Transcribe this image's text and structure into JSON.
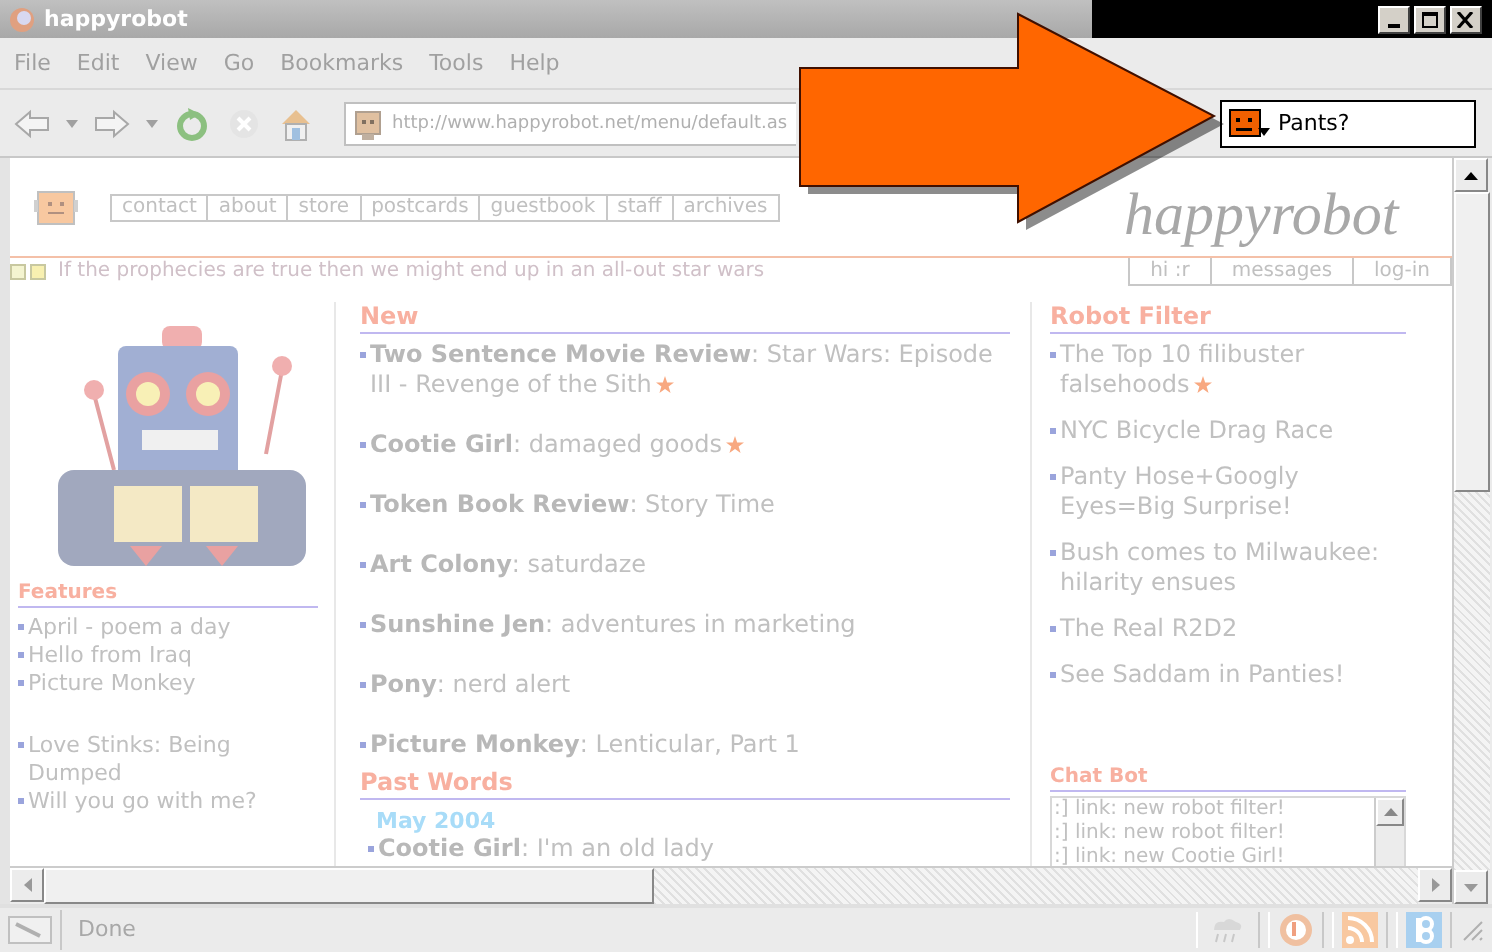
{
  "window": {
    "title": "happyrobot"
  },
  "menu": [
    "File",
    "Edit",
    "View",
    "Go",
    "Bookmarks",
    "Tools",
    "Help"
  ],
  "toolbar": {
    "address": "http://www.happyrobot.net/menu/default.as",
    "search": "Pants?"
  },
  "page": {
    "nav": [
      "contact",
      "about",
      "store",
      "postcards",
      "guestbook",
      "staff",
      "archives"
    ],
    "logo": "happyrobot",
    "user_nav": [
      "hi :r",
      "messages",
      "log-in"
    ],
    "tagline": "If the prophecies are true then we might end up in an all-out star wars",
    "features": {
      "title": "Features",
      "groups": [
        [
          "April - poem a day",
          "Hello from Iraq",
          "Picture Monkey"
        ],
        [
          "Love Stinks: Being Dumped",
          "Will you go with me?"
        ]
      ]
    },
    "new": {
      "title": "New",
      "items": [
        {
          "text": "**Two Sentence Movie Review**: Star Wars: Episode III - Revenge of the Sith",
          "starred": true
        },
        {
          "text": "**Cootie Girl**: damaged goods",
          "starred": true
        },
        {
          "text": "**Token Book Review**: Story Time",
          "starred": false
        },
        {
          "text": "**Art Colony**: saturdaze",
          "starred": false
        },
        {
          "text": "**Sunshine Jen**: adventures in marketing",
          "starred": false
        },
        {
          "text": "**Pony**: nerd alert",
          "starred": false
        },
        {
          "text": "**Picture Monkey**: Lenticular, Part 1",
          "starred": false
        }
      ]
    },
    "past_words": {
      "title": "Past Words",
      "month": "May 2004",
      "items": [
        "**Cootie Girl**: I'm an old lady"
      ]
    },
    "robot_filter": {
      "title": "Robot Filter",
      "items": [
        {
          "text": "The Top 10 filibuster falsehoods",
          "starred": true
        },
        {
          "text": "NYC Bicycle Drag Race",
          "starred": false
        },
        {
          "text": "Panty Hose+Googly Eyes=Big Surprise!",
          "starred": false
        },
        {
          "text": "Bush comes to Milwaukee: hilarity ensues",
          "starred": false
        },
        {
          "text": "The Real R2D2",
          "starred": false
        },
        {
          "text": "See Saddam in Panties!",
          "starred": false
        }
      ]
    },
    "chat_bot": {
      "title": "Chat Bot",
      "lines": [
        ":] link: new robot filter!",
        ":] link: new robot filter!",
        ":] link: new Cootie Girl!"
      ]
    }
  },
  "status_bar": {
    "text": "Done"
  }
}
